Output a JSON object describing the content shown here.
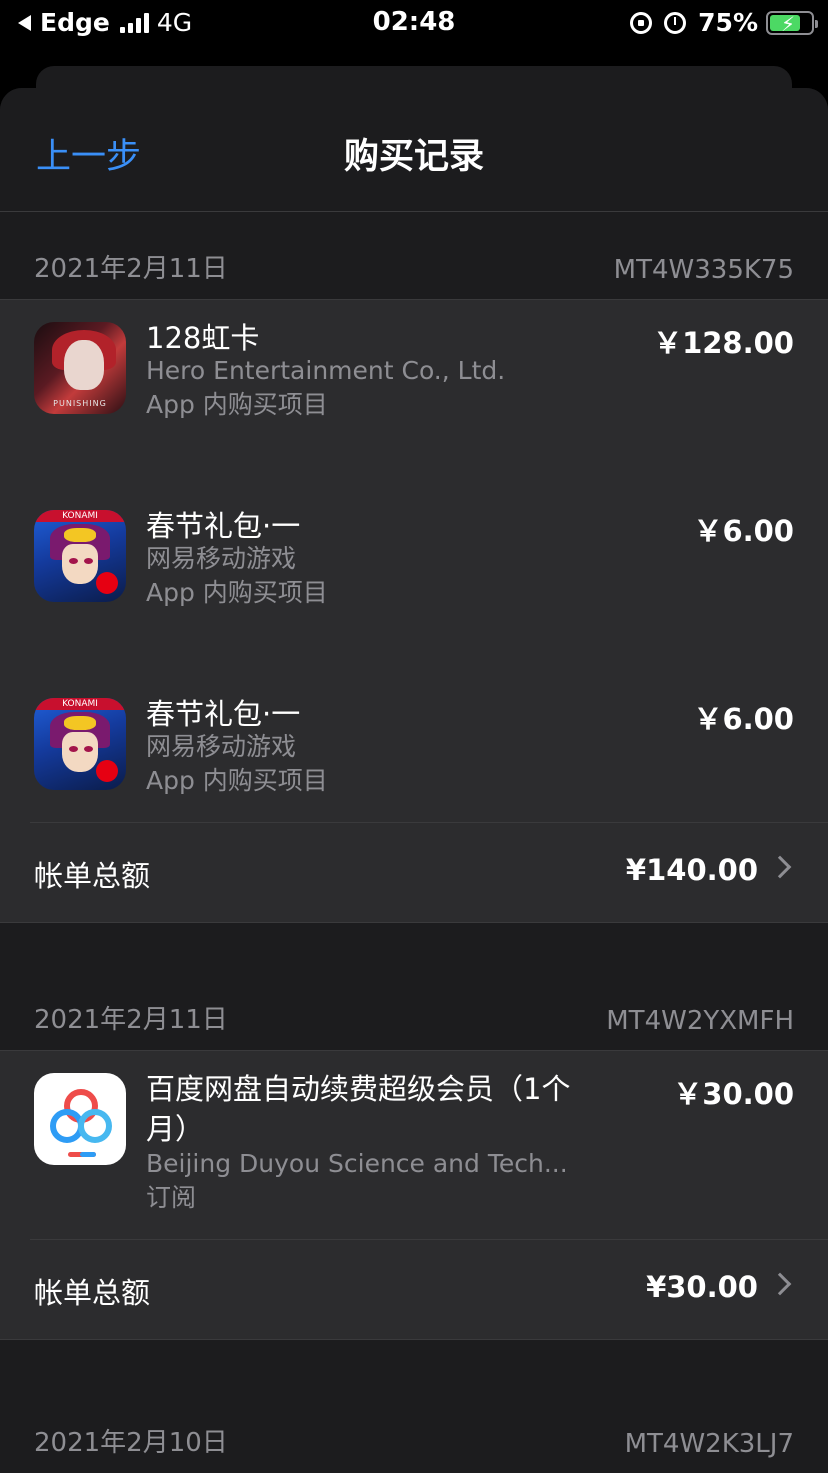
{
  "status_bar": {
    "carrier": "Edge",
    "network": "4G",
    "time": "02:48",
    "battery": "75%",
    "battery_level": 0.75
  },
  "nav": {
    "back_label": "上一步",
    "title": "购买记录"
  },
  "sections": [
    {
      "date": "2021年2月11日",
      "order_id": "MT4W335K75",
      "items": [
        {
          "title": "128虹卡",
          "developer": "Hero Entertainment Co., Ltd.",
          "type": "App 内购买项目",
          "price": "￥128.00",
          "icon": "punishing-game-icon"
        },
        {
          "title": "春节礼包·一",
          "developer": "网易移动游戏",
          "type": "App 内购买项目",
          "price": "￥6.00",
          "icon": "yugioh-game-icon"
        },
        {
          "title": "春节礼包·一",
          "developer": "网易移动游戏",
          "type": "App 内购买项目",
          "price": "￥6.00",
          "icon": "yugioh-game-icon"
        }
      ],
      "total_label": "帐单总额",
      "total": "¥140.00"
    },
    {
      "date": "2021年2月11日",
      "order_id": "MT4W2YXMFH",
      "items": [
        {
          "title": "百度网盘自动续费超级会员（1个月）",
          "developer": "Beijing Duyou Science and Tech...",
          "type": "订阅",
          "price": "￥30.00",
          "icon": "baidu-netdisk-icon"
        }
      ],
      "total_label": "帐单总额",
      "total": "¥30.00"
    },
    {
      "date": "2021年2月10日",
      "order_id": "MT4W2K3LJ7"
    }
  ],
  "icon_text": {
    "punishing": "PUNISHING",
    "konami": "KONAMI"
  },
  "colors": {
    "accent": "#3a8ff7",
    "background": "#1c1c1e",
    "cell": "#2c2c2e",
    "secondary_text": "#8e8e93",
    "battery_fill": "#4cd964"
  }
}
